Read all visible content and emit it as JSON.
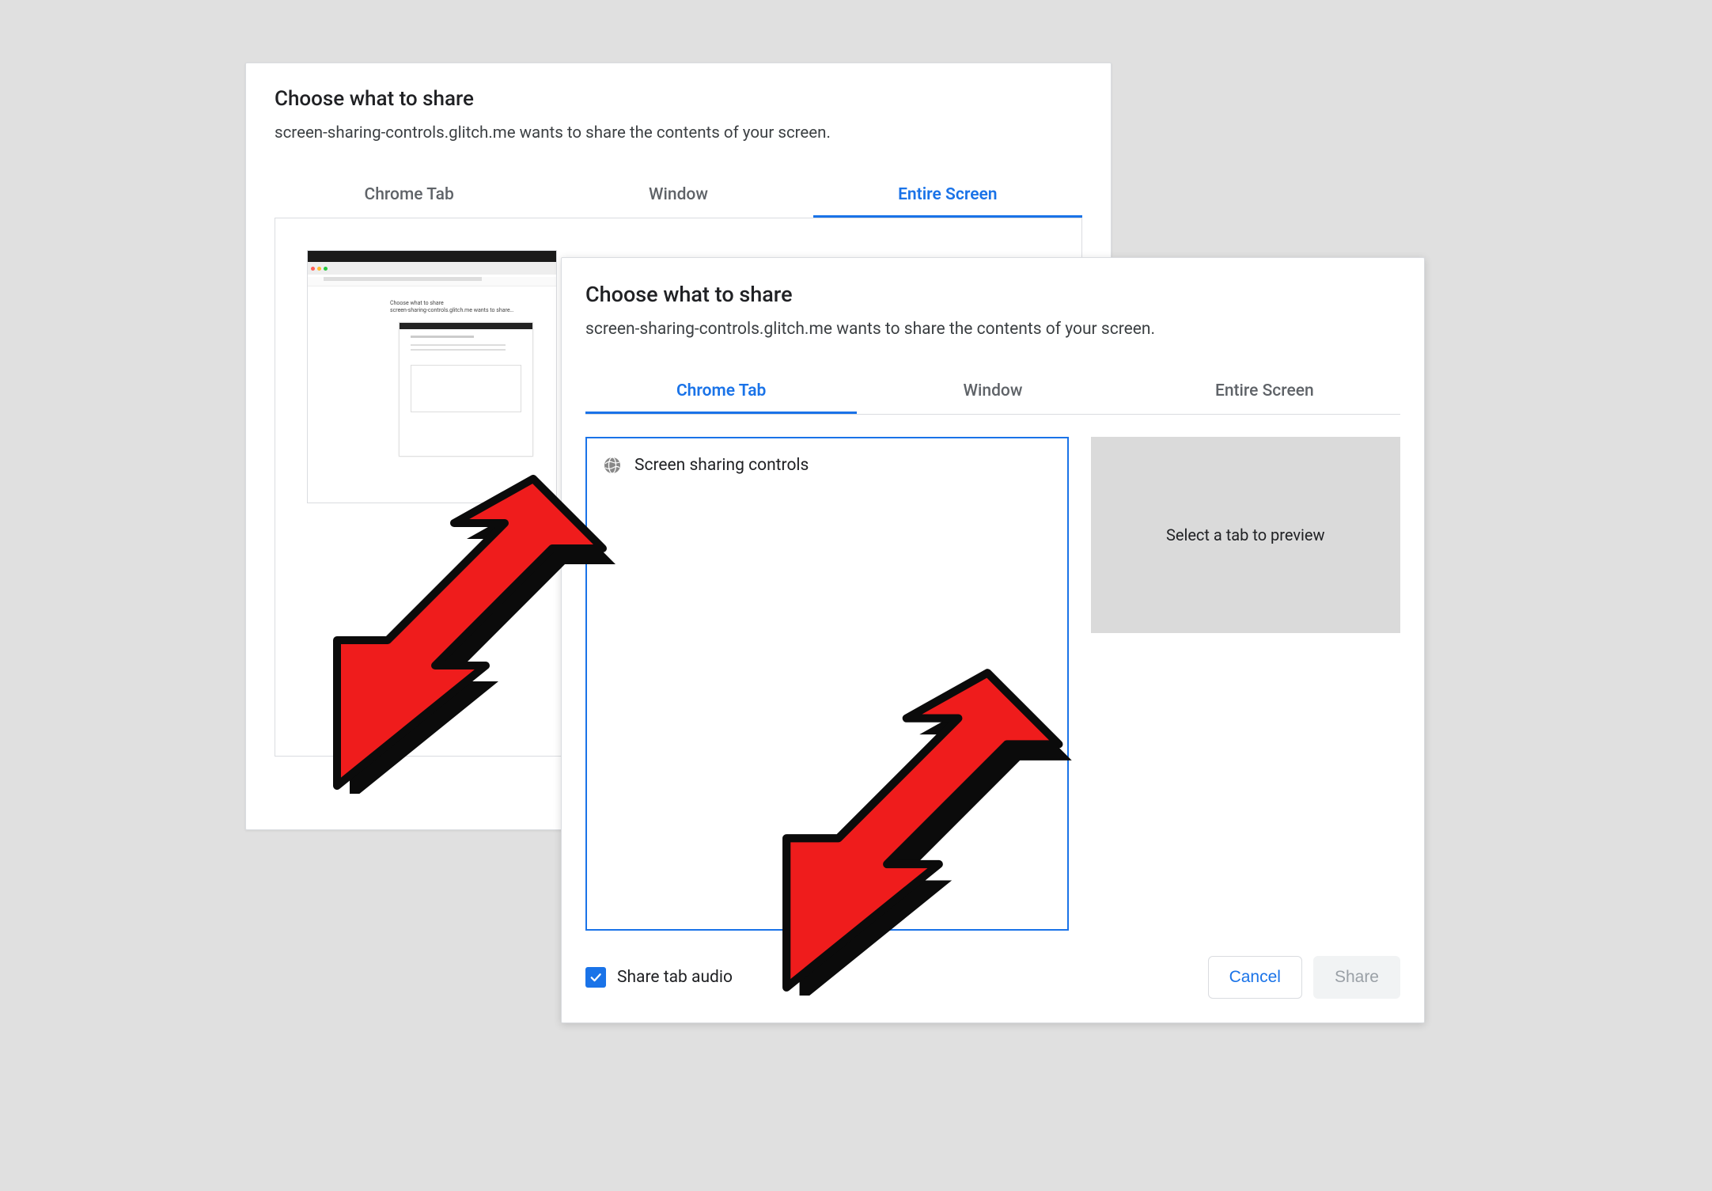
{
  "back_dialog": {
    "title": "Choose what to share",
    "subtitle": "screen-sharing-controls.glitch.me wants to share the contents of your screen.",
    "tabs": [
      "Chrome Tab",
      "Window",
      "Entire Screen"
    ],
    "active_tab_index": 2
  },
  "front_dialog": {
    "title": "Choose what to share",
    "subtitle": "screen-sharing-controls.glitch.me wants to share the contents of your screen.",
    "tabs": [
      "Chrome Tab",
      "Window",
      "Entire Screen"
    ],
    "active_tab_index": 0,
    "tab_list_items": [
      "Screen sharing controls"
    ],
    "preview_placeholder": "Select a tab to preview",
    "share_audio_label": "Share tab audio",
    "share_audio_checked": true,
    "buttons": {
      "cancel": "Cancel",
      "share": "Share"
    }
  },
  "colors": {
    "accent": "#1a73e8"
  }
}
